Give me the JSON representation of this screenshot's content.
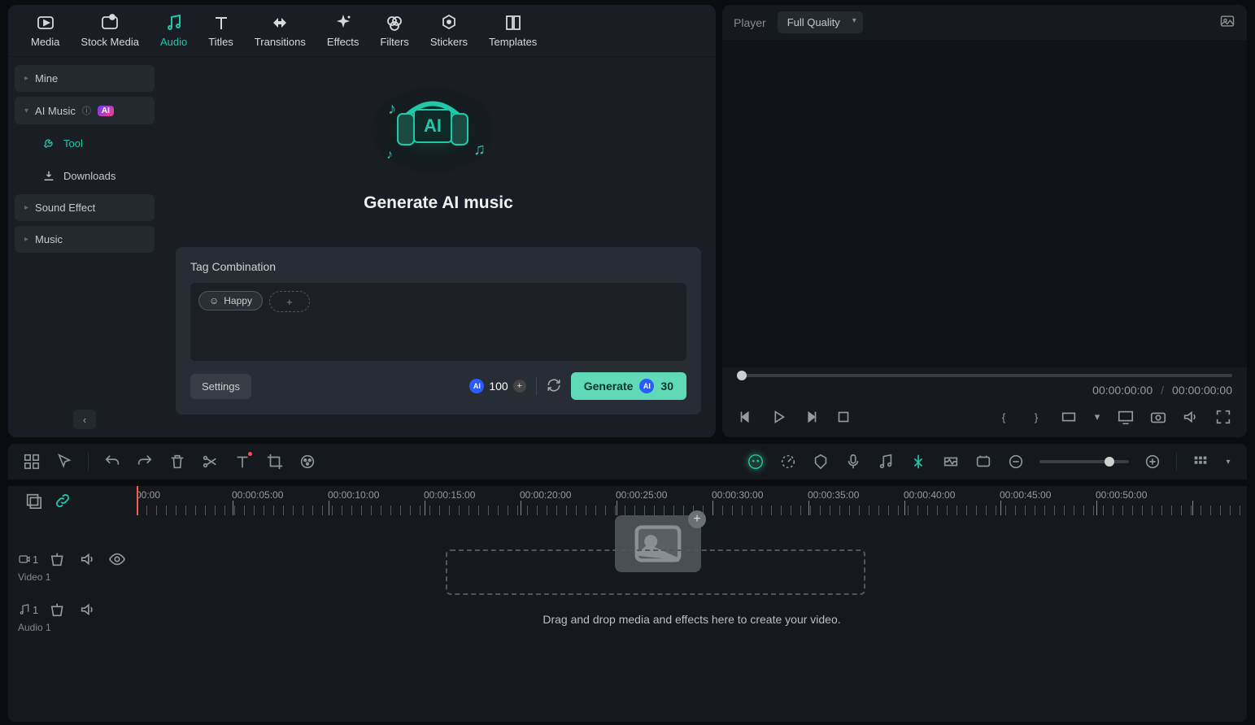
{
  "tabs": {
    "media": "Media",
    "stock_media": "Stock Media",
    "audio": "Audio",
    "titles": "Titles",
    "transitions": "Transitions",
    "effects": "Effects",
    "filters": "Filters",
    "stickers": "Stickers",
    "templates": "Templates",
    "active": "audio"
  },
  "sidebar": {
    "mine": "Mine",
    "ai_music": "AI Music",
    "ai_badge": "AI",
    "tool": "Tool",
    "downloads": "Downloads",
    "sound_effect": "Sound Effect",
    "music": "Music"
  },
  "ai_panel": {
    "title": "Generate AI music",
    "tag_section": "Tag Combination",
    "tags": [
      "Happy"
    ],
    "settings": "Settings",
    "credits_available": "100",
    "generate_label": "Generate",
    "generate_cost": "30"
  },
  "player": {
    "label": "Player",
    "quality": "Full Quality",
    "time_current": "00:00:00:00",
    "time_total": "00:00:00:00"
  },
  "timeline": {
    "ruler": [
      "00:00",
      "00:00:05:00",
      "00:00:10:00",
      "00:00:15:00",
      "00:00:20:00",
      "00:00:25:00",
      "00:00:30:00",
      "00:00:35:00",
      "00:00:40:00",
      "00:00:45:00",
      "00:00:50:00"
    ],
    "tracks": {
      "video": {
        "index": "1",
        "label": "Video 1"
      },
      "audio": {
        "index": "1",
        "label": "Audio 1"
      }
    },
    "drop_hint": "Drag and drop media and effects here to create your video."
  }
}
